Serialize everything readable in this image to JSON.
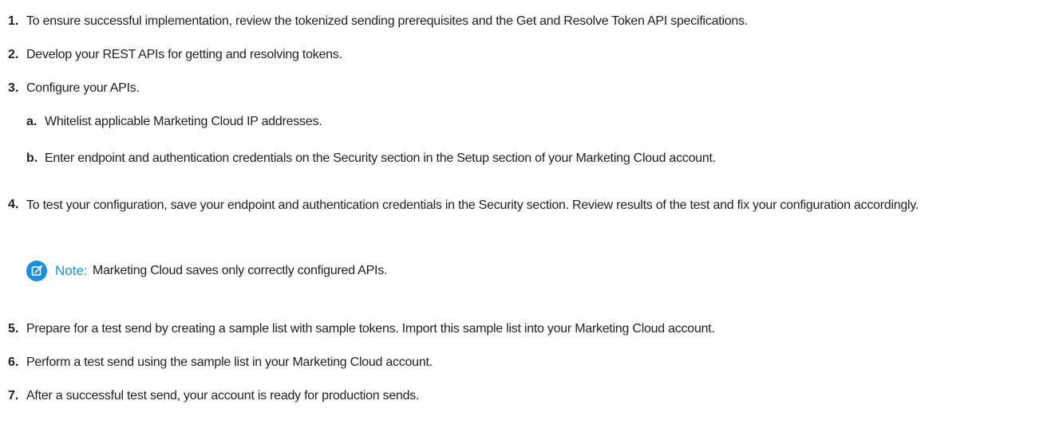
{
  "steps": [
    {
      "num": "1.",
      "text": "To ensure successful implementation, review the tokenized sending prerequisites and the Get and Resolve Token API specifications."
    },
    {
      "num": "2.",
      "text": "Develop your REST APIs for getting and resolving tokens."
    },
    {
      "num": "3.",
      "text": "Configure your APIs."
    },
    {
      "num": "a.",
      "text": "Whitelist applicable Marketing Cloud IP addresses."
    },
    {
      "num": "b.",
      "text": "Enter endpoint and authentication credentials on the Security section in the Setup section of your Marketing Cloud account."
    },
    {
      "num": "4.",
      "text": "To test your configuration, save your endpoint and authentication credentials in the Security section. Review results of the test and fix your configuration accordingly."
    },
    {
      "num": "5.",
      "text": "Prepare for a test send by creating a sample list with sample tokens. Import this sample list into your Marketing Cloud account."
    },
    {
      "num": "6.",
      "text": "Perform a test send using the sample list in your Marketing Cloud account."
    },
    {
      "num": "7.",
      "text": "After a successful test send, your account is ready for production sends."
    }
  ],
  "note": {
    "icon": "note-icon",
    "label": "Note:",
    "text": "Marketing Cloud saves only correctly configured APIs.",
    "accent_color": "#1a8fdc"
  }
}
